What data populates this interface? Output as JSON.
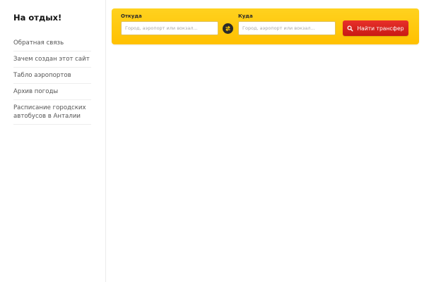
{
  "sidebar": {
    "title": "На отдых!",
    "items": [
      {
        "label": "Обратная связь"
      },
      {
        "label": "Зачем создан этот сайт"
      },
      {
        "label": "Табло аэропортов"
      },
      {
        "label": "Архив погоды"
      },
      {
        "label": "Расписание городских автобусов в Анталии"
      }
    ]
  },
  "search": {
    "from_label": "Откуда",
    "from_placeholder": "Город, аэропорт или вокзал...",
    "from_value": "",
    "to_label": "Куда",
    "to_placeholder": "Город, аэропорт или вокзал...",
    "to_value": "",
    "swap_icon": "swap-arrows-icon",
    "button_label": "Найти трансфер",
    "button_icon": "search-icon"
  },
  "colors": {
    "panel": "#ffc800",
    "button": "#d82420",
    "swap": "#2b2b2b"
  }
}
